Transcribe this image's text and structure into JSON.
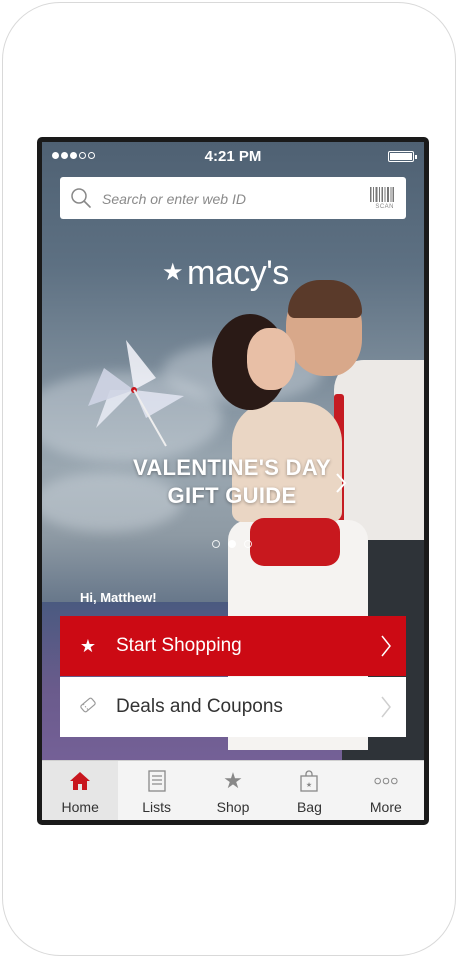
{
  "status_bar": {
    "time": "4:21 PM",
    "signal_dots": 5
  },
  "search": {
    "placeholder": "Search or enter web ID",
    "scan_label": "SCAN"
  },
  "brand": {
    "logo_text": "macy's",
    "star": "★"
  },
  "hero": {
    "line1": "VALENTINE'S DAY",
    "line2": "GIFT GUIDE",
    "carousel": {
      "count": 3,
      "active_index": 1
    }
  },
  "greeting": "Hi, Matthew!",
  "actions": [
    {
      "label": "Start Shopping",
      "icon": "star-icon"
    },
    {
      "label": "Deals and Coupons",
      "icon": "coupon-tag-icon"
    }
  ],
  "tabbar": {
    "active": "Home",
    "tabs": [
      {
        "label": "Home",
        "icon": "home-icon"
      },
      {
        "label": "Lists",
        "icon": "list-icon"
      },
      {
        "label": "Shop",
        "icon": "star-icon"
      },
      {
        "label": "Bag",
        "icon": "bag-icon"
      },
      {
        "label": "More",
        "icon": "more-icon"
      }
    ]
  },
  "colors": {
    "primary_red": "#cc0a14",
    "tab_active": "#c8161e"
  }
}
